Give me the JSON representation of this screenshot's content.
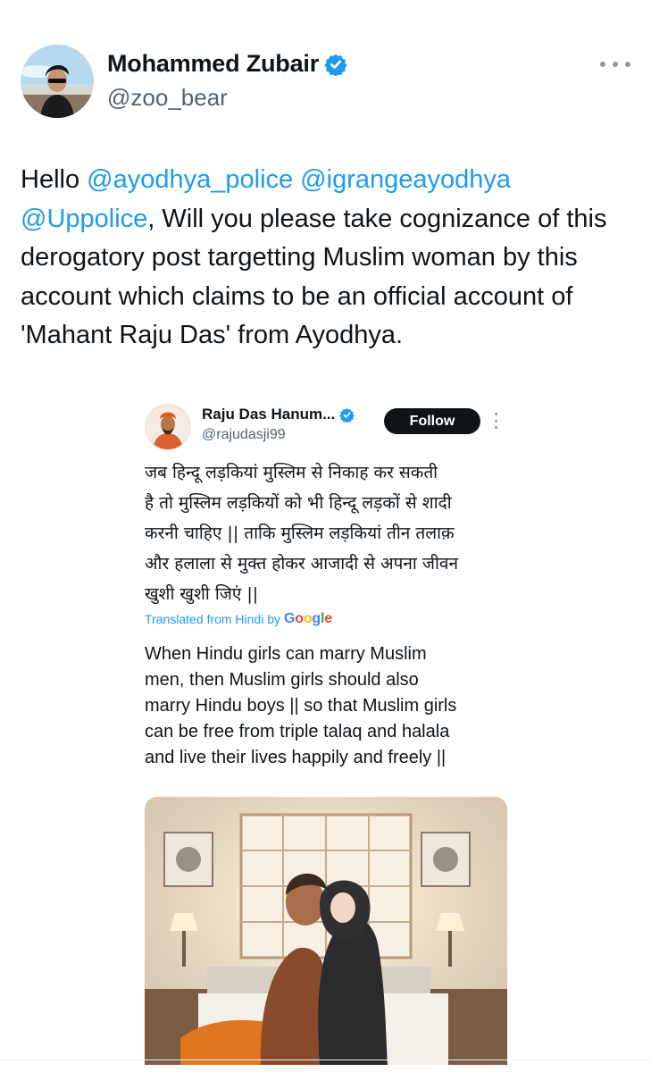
{
  "author": {
    "name": "Mohammed Zubair",
    "handle": "@zoo_bear"
  },
  "tweet": {
    "segments": [
      {
        "text": "Hello ",
        "type": "text"
      },
      {
        "text": "@ayodhya_police",
        "type": "mention"
      },
      {
        "text": " ",
        "type": "text"
      },
      {
        "text": "@igrangeayodhya",
        "type": "mention"
      },
      {
        "text": " ",
        "type": "text"
      },
      {
        "text": "@Uppolice",
        "type": "mention"
      },
      {
        "text": ", Will you please take cognizance of this derogatory post targetting Muslim woman by this account which claims to be an official account of 'Mahant Raju Das' from Ayodhya.",
        "type": "text"
      }
    ]
  },
  "embed": {
    "name": "Raju Das Hanum...",
    "handle": "@rajudasji99",
    "follow_label": "Follow",
    "hindi_text": "जब हिन्दू लड़कियां मुस्लिम से निकाह कर सकती\nहै तो मुस्लिम लड़कियों को भी हिन्दू लड़कों से शादी\nकरनी चाहिए || ताकि मुस्लिम लड़कियां तीन तलाक़\nऔर हलाला से मुक्त होकर आजादी से अपना जीवन\nखुशी खुशी जिएं ||",
    "translated_label": "Translated from Hindi by",
    "translator": "Google",
    "english_text": "When Hindu girls can marry Muslim\nmen, then Muslim girls should also\nmarry Hindu boys || so that Muslim girls\ncan be free from triple talaq and halala\nand live their lives happily and freely ||"
  },
  "colors": {
    "link": "#1d9bf0",
    "verified": "#1d9bf0",
    "text": "#0f1419",
    "secondary": "#536471"
  },
  "icons": [
    "verified-badge-icon",
    "more-options-icon"
  ]
}
